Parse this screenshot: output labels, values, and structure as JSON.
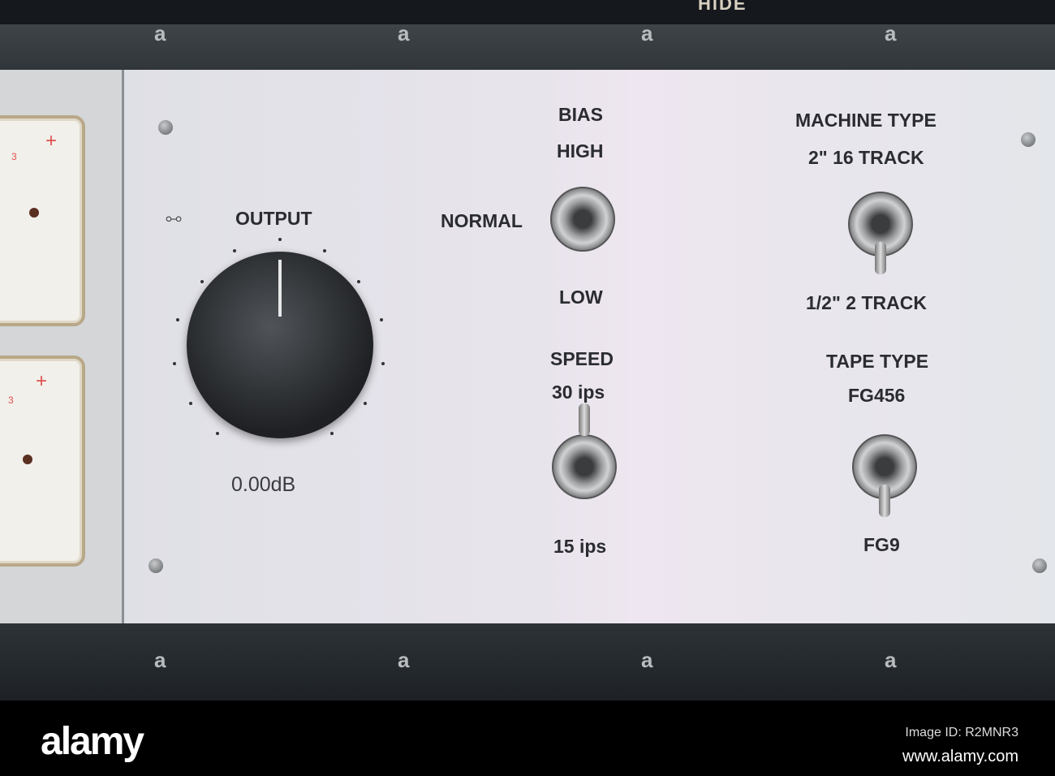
{
  "header": {
    "partial_title": "HIDE"
  },
  "output": {
    "label": "OUTPUT",
    "value": "0.00dB",
    "link_icon": "link-icon"
  },
  "bias": {
    "label": "BIAS",
    "high": "HIGH",
    "normal": "NORMAL",
    "low": "LOW"
  },
  "speed": {
    "label": "SPEED",
    "high": "30 ips",
    "low": "15 ips"
  },
  "machine_type": {
    "label": "MACHINE TYPE",
    "top": "2\" 16 TRACK",
    "bottom": "1/2\" 2 TRACK"
  },
  "tape_type": {
    "label": "TAPE TYPE",
    "top": "FG456",
    "bottom": "FG9"
  },
  "meters": {
    "plus": "+",
    "scale": "3"
  },
  "watermark": {
    "logo": "alamy",
    "image_id": "Image ID: R2MNR3",
    "site": "www.alamy.com",
    "mark": "a"
  }
}
